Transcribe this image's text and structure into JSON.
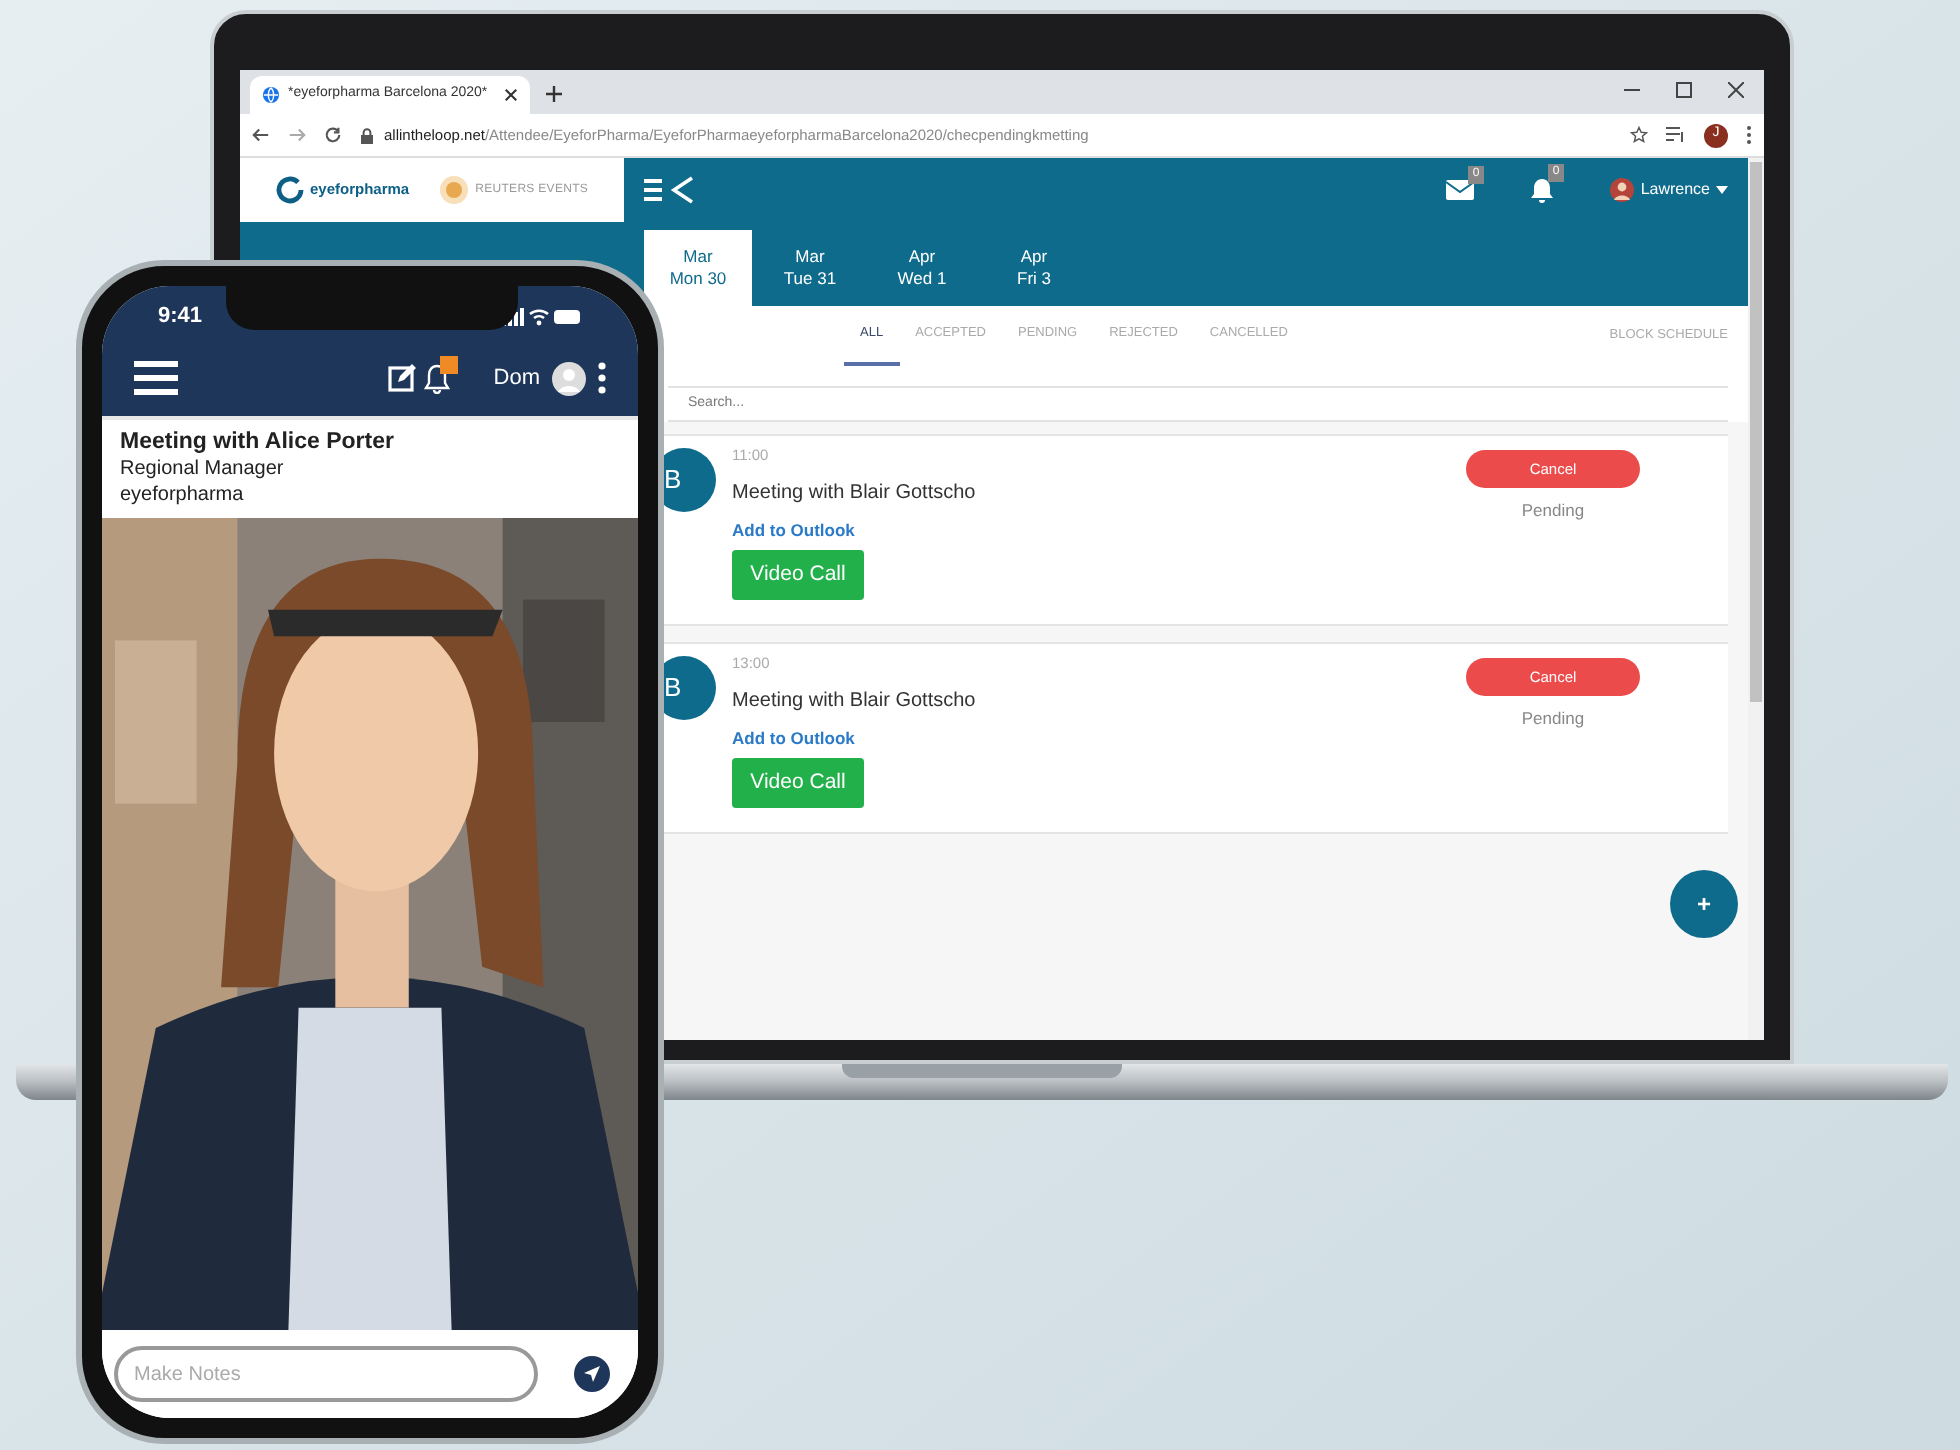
{
  "laptop": {
    "browser": {
      "tab_title": "*eyeforpharma Barcelona 2020*",
      "url_host": "allintheloop.net",
      "url_path": "/Attendee/EyeforPharma/EyeforPharmaeyeforpharmaBarcelona2020/checpendingkmetting",
      "profile_initial": "J"
    },
    "app": {
      "logos": [
        {
          "kind": "ring",
          "text": "eyeforpharma"
        },
        {
          "kind": "dots",
          "text": "REUTERS EVENTS"
        }
      ],
      "header": {
        "mail_count": "0",
        "notification_count": "0",
        "user": "Lawrence"
      },
      "date_tabs": [
        {
          "month": "Mar",
          "day": "Mon 30",
          "selected": true
        },
        {
          "month": "Mar",
          "day": "Tue 31",
          "selected": false
        },
        {
          "month": "Apr",
          "day": "Wed 1",
          "selected": false
        },
        {
          "month": "Apr",
          "day": "Fri 3",
          "selected": false
        }
      ],
      "filter_tabs": [
        {
          "label": "ALL",
          "selected": true
        },
        {
          "label": "ACCEPTED",
          "selected": false
        },
        {
          "label": "PENDING",
          "selected": false
        },
        {
          "label": "REJECTED",
          "selected": false
        },
        {
          "label": "CANCELLED",
          "selected": false
        }
      ],
      "block_schedule": "BLOCK SCHEDULE",
      "search": {
        "placeholder": "Search..."
      },
      "meetings": [
        {
          "avatar": "B",
          "time": "11:00",
          "title": "Meeting with Blair Gottscho",
          "link": "Add to Outlook",
          "call_button": "Video Call",
          "cancel_button": "Cancel",
          "status": "Pending"
        },
        {
          "avatar": "B",
          "time": "13:00",
          "title": "Meeting with Blair Gottscho",
          "link": "Add to Outlook",
          "call_button": "Video Call",
          "cancel_button": "Cancel",
          "status": "Pending"
        }
      ],
      "fab": "+"
    }
  },
  "phone": {
    "time": "9:41",
    "user": "Dom",
    "meeting": {
      "title": "Meeting with Alice Porter",
      "role": "Regional Manager",
      "company": "eyeforpharma"
    },
    "notes": {
      "placeholder": "Make Notes"
    }
  }
}
